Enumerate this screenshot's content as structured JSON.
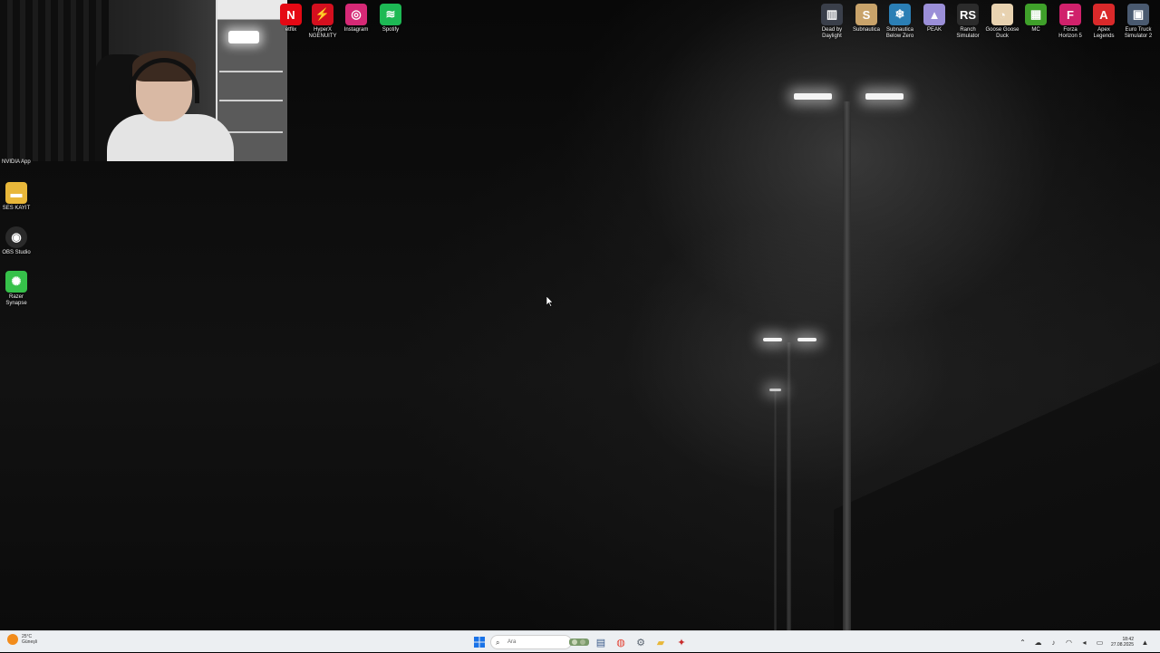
{
  "desktop": {
    "top_icons": [
      {
        "label": "etflix",
        "color": "#e50914",
        "glyph": "N"
      },
      {
        "label": "HyperX\nNGENUITY",
        "color": "#d40f1e",
        "glyph": "⚡"
      },
      {
        "label": "Instagram",
        "color": "#d62976",
        "glyph": "◎"
      },
      {
        "label": "Spotify",
        "color": "#1db954",
        "glyph": "≋"
      },
      {
        "label": "Dead by\nDaylight",
        "color": "#3a3f4a",
        "glyph": "▥"
      },
      {
        "label": "Subnautica",
        "color": "#c9a36a",
        "glyph": "S"
      },
      {
        "label": "Subnautica\nBelow Zero",
        "color": "#2b7fb5",
        "glyph": "❄"
      },
      {
        "label": "PEAK",
        "color": "#9b8fd8",
        "glyph": "▲"
      },
      {
        "label": "Ranch\nSimulator",
        "color": "#2b2b2b",
        "glyph": "RS"
      },
      {
        "label": "Goose Goose\nDuck",
        "color": "#e8d2b0",
        "glyph": "◔"
      },
      {
        "label": "MC",
        "color": "#3fa02a",
        "glyph": "▦"
      },
      {
        "label": "Forza\nHorizon 5",
        "color": "#d0216b",
        "glyph": "F"
      },
      {
        "label": "Apex\nLegends",
        "color": "#da292a",
        "glyph": "A"
      },
      {
        "label": "Euro Truck\nSimulator 2",
        "color": "#4a5a70",
        "glyph": "▣"
      }
    ],
    "left_icons": [
      {
        "label": "SES KAYIT",
        "color": "#e8b73a",
        "glyph": "▬"
      },
      {
        "label": "OBS Studio",
        "color": "#2a2a2a",
        "glyph": "◉"
      },
      {
        "label": "Razer\nSynapse",
        "color": "#36c14a",
        "glyph": "✺"
      }
    ],
    "nvidia_label": "NVIDIA App"
  },
  "taskbar": {
    "weather_temp": "25°C",
    "weather_desc": "Güneşli",
    "search_placeholder": "Ara",
    "time": "18:42",
    "date": "27.08.2025",
    "pinned": [
      {
        "name": "start-button",
        "glyph": "⊞",
        "color": "#1a73e8"
      },
      {
        "name": "file-manager-icon",
        "glyph": "▤",
        "color": "#3a5b8a"
      },
      {
        "name": "chrome-icon",
        "glyph": "◍",
        "color": "#e34133"
      },
      {
        "name": "settings-icon",
        "glyph": "⚙",
        "color": "#5a6470"
      },
      {
        "name": "folder-icon",
        "glyph": "▰",
        "color": "#e8b73a"
      },
      {
        "name": "app-icon",
        "glyph": "✦",
        "color": "#c82a2a"
      }
    ],
    "colors": {
      "accent": "#1a73e8",
      "bar": "#eceff2"
    }
  }
}
